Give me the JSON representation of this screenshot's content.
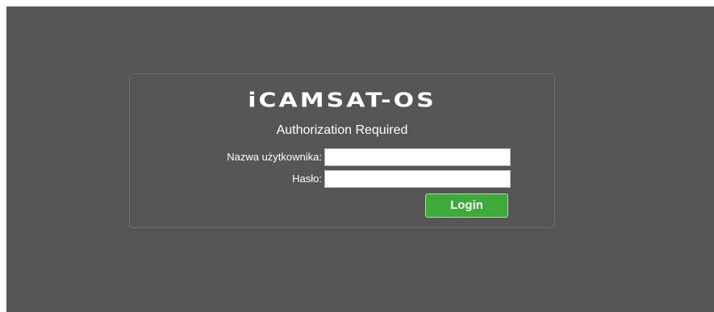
{
  "header": {
    "brand": "iCAMSAT-OS",
    "subtitle": "Authorization Required"
  },
  "form": {
    "username_label": "Nazwa użytkownika:",
    "username_value": "",
    "password_label": "Hasło:",
    "password_value": "",
    "login_label": "Login"
  },
  "colors": {
    "background": "#555555",
    "accent": "#3daa3a"
  }
}
